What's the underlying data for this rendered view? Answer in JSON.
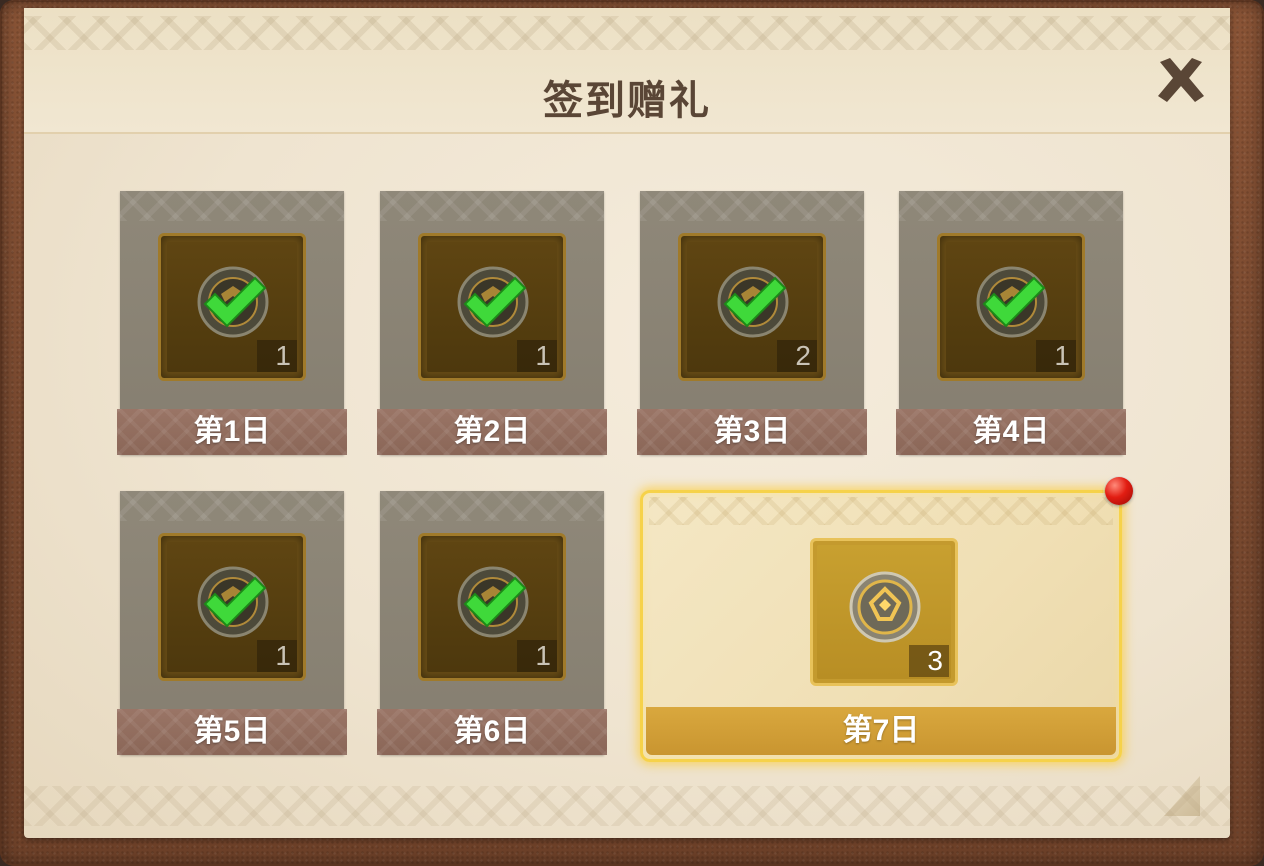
{
  "dialog": {
    "title": "签到赠礼",
    "close_icon": "close-x-icon"
  },
  "days": [
    {
      "label": "第1日",
      "count": "1",
      "claimed": true,
      "icon": "gear-orb-icon"
    },
    {
      "label": "第2日",
      "count": "1",
      "claimed": true,
      "icon": "gear-orb-icon"
    },
    {
      "label": "第3日",
      "count": "2",
      "claimed": true,
      "icon": "gear-orb-icon"
    },
    {
      "label": "第4日",
      "count": "1",
      "claimed": true,
      "icon": "gear-orb-icon"
    },
    {
      "label": "第5日",
      "count": "1",
      "claimed": true,
      "icon": "gear-orb-icon"
    },
    {
      "label": "第6日",
      "count": "1",
      "claimed": true,
      "icon": "gear-orb-icon"
    },
    {
      "label": "第7日",
      "count": "3",
      "claimed": false,
      "claimable": true,
      "icon": "gold-orb-icon"
    }
  ],
  "colors": {
    "claimed_check": "#3fd93a",
    "highlight_border": "#f6d24a",
    "notification_dot": "#e21d12",
    "title_text": "#5a4636"
  }
}
